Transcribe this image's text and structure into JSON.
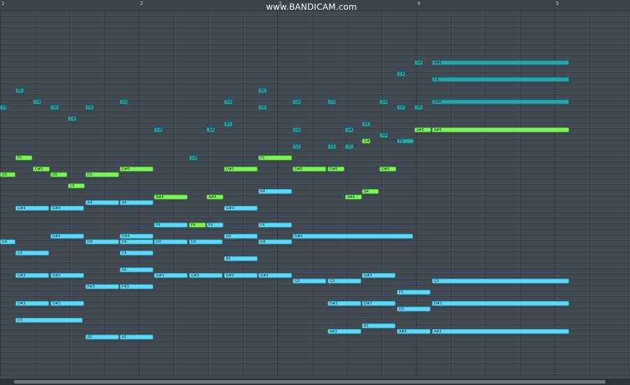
{
  "watermark": "www.BANDICAM.com",
  "ruler": {
    "bar_numbers": [
      "1",
      "2",
      "3",
      "4",
      "5"
    ]
  },
  "colors": {
    "background": "#414a52",
    "cyan": "#5fd8f7",
    "green": "#7cf35e",
    "teal": "#2aa2a6"
  },
  "notes": [
    {
      "label": "A#6",
      "color": "teal"
    },
    {
      "label": "A#6",
      "color": "teal"
    },
    {
      "label": "C#6",
      "color": "teal"
    },
    {
      "label": "C6",
      "color": "teal"
    },
    {
      "label": "B6",
      "color": "teal"
    },
    {
      "label": "B6",
      "color": "teal"
    },
    {
      "label": "D6",
      "color": "teal"
    },
    {
      "label": "D#6",
      "color": "teal"
    },
    {
      "label": "D6",
      "color": "teal"
    },
    {
      "label": "D6",
      "color": "teal"
    },
    {
      "label": "D#6",
      "color": "teal"
    },
    {
      "label": "D#6",
      "color": "teal"
    },
    {
      "label": "D6",
      "color": "teal"
    },
    {
      "label": "D#6",
      "color": "teal"
    },
    {
      "label": "D#6",
      "color": "teal"
    },
    {
      "label": "D#6",
      "color": "teal"
    },
    {
      "label": "D6",
      "color": "teal"
    },
    {
      "label": "D6",
      "color": "teal"
    },
    {
      "label": "D#6",
      "color": "teal"
    },
    {
      "label": "C#6",
      "color": "teal"
    },
    {
      "label": "C#6",
      "color": "teal"
    },
    {
      "label": "B5",
      "color": "teal"
    },
    {
      "label": "B5",
      "color": "teal"
    },
    {
      "label": "A#5",
      "color": "teal"
    },
    {
      "label": "A#5",
      "color": "teal"
    },
    {
      "label": "A#5",
      "color": "teal"
    },
    {
      "label": "A#5",
      "color": "teal"
    },
    {
      "label": "A#5",
      "color": "green"
    },
    {
      "label": "A#5",
      "color": "green"
    },
    {
      "label": "G#5",
      "color": "teal"
    },
    {
      "label": "G#5",
      "color": "green"
    },
    {
      "label": "G5",
      "color": "teal"
    },
    {
      "label": "G5",
      "color": "teal"
    },
    {
      "label": "G5",
      "color": "teal"
    },
    {
      "label": "F5",
      "color": "green"
    },
    {
      "label": "F5",
      "color": "green"
    },
    {
      "label": "F5",
      "color": "teal"
    },
    {
      "label": "D#5",
      "color": "green"
    },
    {
      "label": "D#5",
      "color": "green"
    },
    {
      "label": "D#5",
      "color": "green"
    },
    {
      "label": "D#5",
      "color": "green"
    },
    {
      "label": "D#5",
      "color": "green"
    },
    {
      "label": "D#5",
      "color": "green"
    },
    {
      "label": "D5",
      "color": "green"
    },
    {
      "label": "D5",
      "color": "green"
    },
    {
      "label": "D5",
      "color": "green"
    },
    {
      "label": "C5",
      "color": "green"
    },
    {
      "label": "B4",
      "color": "cyan"
    },
    {
      "label": "B4",
      "color": "green"
    },
    {
      "label": "A#4",
      "color": "green"
    },
    {
      "label": "A#4",
      "color": "green"
    },
    {
      "label": "A#4",
      "color": "green"
    },
    {
      "label": "A4",
      "color": "cyan"
    },
    {
      "label": "A4",
      "color": "cyan"
    },
    {
      "label": "G#4",
      "color": "cyan"
    },
    {
      "label": "G#4",
      "color": "cyan"
    },
    {
      "label": "G#4",
      "color": "cyan"
    },
    {
      "label": "F4",
      "color": "cyan"
    },
    {
      "label": "F4",
      "color": "green"
    },
    {
      "label": "F4",
      "color": "cyan"
    },
    {
      "label": "F4",
      "color": "cyan"
    },
    {
      "label": "D#4",
      "color": "cyan"
    },
    {
      "label": "D#4",
      "color": "cyan"
    },
    {
      "label": "D4",
      "color": "cyan"
    },
    {
      "label": "D#4",
      "color": "cyan"
    },
    {
      "label": "D4",
      "color": "cyan"
    },
    {
      "label": "D4",
      "color": "cyan"
    },
    {
      "label": "D4",
      "color": "cyan"
    },
    {
      "label": "D4",
      "color": "cyan"
    },
    {
      "label": "D4",
      "color": "cyan"
    },
    {
      "label": "D4",
      "color": "cyan"
    },
    {
      "label": "C4",
      "color": "cyan"
    },
    {
      "label": "C4",
      "color": "cyan"
    },
    {
      "label": "B3",
      "color": "cyan"
    },
    {
      "label": "A3",
      "color": "cyan"
    },
    {
      "label": "G#3",
      "color": "cyan"
    },
    {
      "label": "G#3",
      "color": "cyan"
    },
    {
      "label": "G#3",
      "color": "cyan"
    },
    {
      "label": "G#3",
      "color": "cyan"
    },
    {
      "label": "G#3",
      "color": "cyan"
    },
    {
      "label": "G#3",
      "color": "cyan"
    },
    {
      "label": "G#3",
      "color": "cyan"
    },
    {
      "label": "G3",
      "color": "cyan"
    },
    {
      "label": "G3",
      "color": "cyan"
    },
    {
      "label": "G3",
      "color": "cyan"
    },
    {
      "label": "F#3",
      "color": "cyan"
    },
    {
      "label": "F#3",
      "color": "cyan"
    },
    {
      "label": "F3",
      "color": "cyan"
    },
    {
      "label": "D#3",
      "color": "cyan"
    },
    {
      "label": "D#3",
      "color": "cyan"
    },
    {
      "label": "D#3",
      "color": "cyan"
    },
    {
      "label": "D#3",
      "color": "cyan"
    },
    {
      "label": "D#3",
      "color": "cyan"
    },
    {
      "label": "D3",
      "color": "cyan"
    },
    {
      "label": "C3",
      "color": "cyan"
    },
    {
      "label": "B2",
      "color": "cyan"
    },
    {
      "label": "A#2",
      "color": "cyan"
    },
    {
      "label": "A#2",
      "color": "cyan"
    },
    {
      "label": "A#2",
      "color": "cyan"
    },
    {
      "label": "A2",
      "color": "cyan"
    },
    {
      "label": "A2",
      "color": "cyan"
    }
  ]
}
